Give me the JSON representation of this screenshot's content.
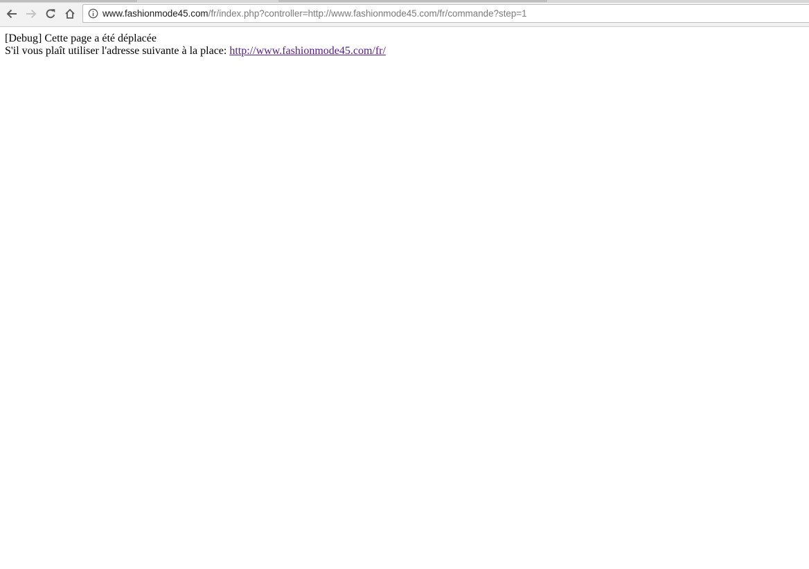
{
  "browser": {
    "url_host": "www.fashionmode45.com",
    "url_path": "/fr/index.php?controller=http://www.fashionmode45.com/fr/commande?step=1"
  },
  "page": {
    "debug_line": "[Debug] Cette page a été déplacée",
    "instruction_text": "S'il vous plaît utiliser l'adresse suivante à la place:",
    "redirect_link": "http://www.fashionmode45.com/fr/"
  },
  "colors": {
    "visited_link": "#551a8b",
    "toolbar_bg": "#f2f2f2"
  }
}
